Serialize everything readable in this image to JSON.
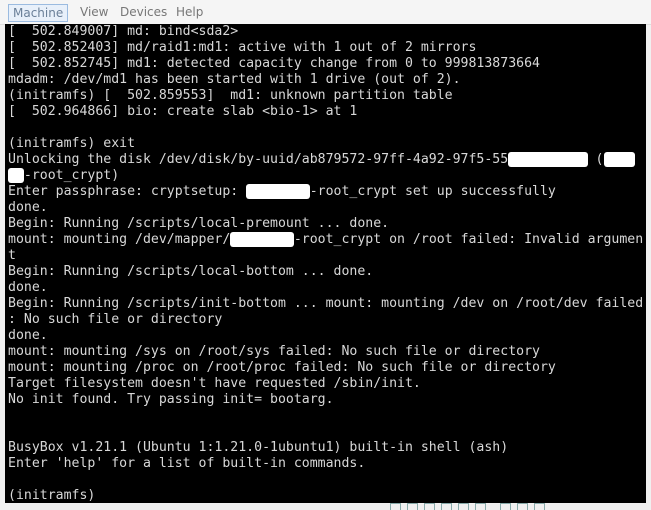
{
  "menu": {
    "items": [
      "Machine",
      "View",
      "Devices",
      "Help"
    ],
    "active": "Machine"
  },
  "terminal": {
    "lines": [
      [
        {
          "t": "[  502.849007] md: bind<sda2>"
        }
      ],
      [
        {
          "t": "[  502.852403] md/raid1:md1: active with 1 out of 2 mirrors"
        }
      ],
      [
        {
          "t": "[  502.852745] md1: detected capacity change from 0 to 999813873664"
        }
      ],
      [
        {
          "t": "mdadm: /dev/md1 has been started with 1 drive (out of 2)."
        }
      ],
      [
        {
          "t": "(initramfs) [  502.859553]  md1: unknown partition table"
        }
      ],
      [
        {
          "t": "[  502.964866] bio: create slab <bio-1> at 1"
        }
      ],
      [
        {
          "t": ""
        }
      ],
      [
        {
          "t": "(initramfs) exit"
        }
      ],
      [
        {
          "t": "Unlocking the disk /dev/disk/by-uuid/ab879572-97ff-4a92-97f5-55"
        },
        {
          "t": "xxxxxxxxxx",
          "r": true
        },
        {
          "t": " ("
        },
        {
          "t": "xxxx",
          "r": true
        }
      ],
      [
        {
          "t": "xx",
          "r": true
        },
        {
          "t": "-root_crypt)"
        }
      ],
      [
        {
          "t": "Enter passphrase: cryptsetup: "
        },
        {
          "t": "xxxxxxxx",
          "r": true
        },
        {
          "t": "-root_crypt set up successfully"
        }
      ],
      [
        {
          "t": "done."
        }
      ],
      [
        {
          "t": "Begin: Running /scripts/local-premount ... done."
        }
      ],
      [
        {
          "t": "mount: mounting /dev/mapper/"
        },
        {
          "t": "xxxxxxxx",
          "r": true
        },
        {
          "t": "-root_crypt on /root failed: Invalid argumen"
        }
      ],
      [
        {
          "t": "t"
        }
      ],
      [
        {
          "t": "Begin: Running /scripts/local-bottom ... done."
        }
      ],
      [
        {
          "t": "done."
        }
      ],
      [
        {
          "t": "Begin: Running /scripts/init-bottom ... mount: mounting /dev on /root/dev failed"
        }
      ],
      [
        {
          "t": ": No such file or directory"
        }
      ],
      [
        {
          "t": "done."
        }
      ],
      [
        {
          "t": "mount: mounting /sys on /root/sys failed: No such file or directory"
        }
      ],
      [
        {
          "t": "mount: mounting /proc on /root/proc failed: No such file or directory"
        }
      ],
      [
        {
          "t": "Target filesystem doesn't have requested /sbin/init."
        }
      ],
      [
        {
          "t": "No init found. Try passing init= bootarg."
        }
      ],
      [
        {
          "t": ""
        }
      ],
      [
        {
          "t": ""
        }
      ],
      [
        {
          "t": "BusyBox v1.21.1 (Ubuntu 1:1.21.0-1ubuntu1) built-in shell (ash)"
        }
      ],
      [
        {
          "t": "Enter 'help' for a list of built-in commands."
        }
      ],
      [
        {
          "t": ""
        }
      ],
      [
        {
          "t": "(initramfs)"
        }
      ]
    ]
  },
  "statusbar": {
    "icons": [
      "hard-disk-icon",
      "optical-drive-icon",
      "usb-icon",
      "shared-folder-icon",
      "display-icon",
      "network-icon",
      "recording-icon",
      "mouse-integration-icon",
      "host-key-icon"
    ]
  }
}
